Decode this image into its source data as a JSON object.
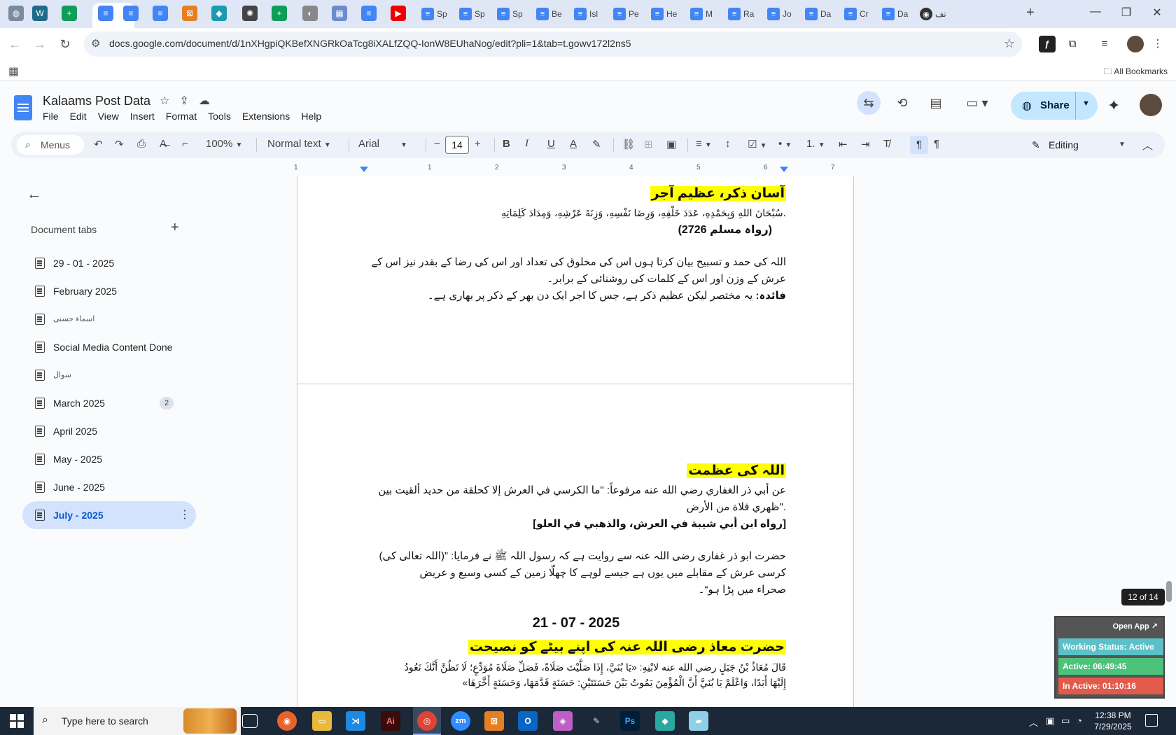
{
  "browser": {
    "tabs": [
      "Sp",
      "Sp",
      "Sp",
      "Be",
      "Isl",
      "Pe",
      "He",
      "M",
      "Ra",
      "Jo",
      "Da",
      "Cr",
      "Da",
      "تف"
    ],
    "url": "docs.google.com/document/d/1nXHgpiQKBefXNGRkOaTcg8iXALfZQQ-IonW8EUhaNog/edit?pli=1&tab=t.gowv172l2ns5",
    "all_bookmarks": "All Bookmarks",
    "new_tab": "+"
  },
  "docs": {
    "title": "Kalaams Post Data",
    "menu": [
      "File",
      "Edit",
      "View",
      "Insert",
      "Format",
      "Tools",
      "Extensions",
      "Help"
    ],
    "share_label": "Share"
  },
  "toolbar": {
    "menus_label": "Menus",
    "zoom": "100%",
    "style": "Normal text",
    "font": "Arial",
    "font_size": "14",
    "mode": "Editing"
  },
  "ruler": [
    "1",
    "1",
    "2",
    "3",
    "4",
    "5",
    "6",
    "7"
  ],
  "sidebar": {
    "heading": "Document tabs",
    "tabs": [
      {
        "label": "29 - 01 - 2025"
      },
      {
        "label": "February 2025"
      },
      {
        "label": "اسماء حسنی"
      },
      {
        "label": "Social Media Content Done"
      },
      {
        "label": "سوال"
      },
      {
        "label": "March 2025",
        "badge": "2"
      },
      {
        "label": "April 2025"
      },
      {
        "label": "May - 2025"
      },
      {
        "label": "June - 2025"
      },
      {
        "label": "July - 2025"
      }
    ]
  },
  "document": {
    "page1": {
      "heading": "آسان ذکر، عظیم آجر",
      "arabic": ".سُبْحَانَ اللهِ وَبِحَمْدِهِ، عَدَدَ خَلْقِهِ، وَرِضَا نَفْسِهِ، وَزِنَةَ عَرْشِهِ، وَمِدَادَ كَلِمَاتِهِ",
      "reference": "(رواہ مسلم 2726)",
      "translation_1": "اللہ کی حمد و تسبیح بیان کرتا ہوں اس کی مخلوق کی تعداد اور اس کی رضا کے بقدر نیز اس کے",
      "translation_2": "عرش کے وزن اور اس کے کلمات کی روشنائی کے برابر۔",
      "benefit_label": "فائدہ:",
      "benefit_text": " یہ مختصر لیکن عظیم ذکر ہے، جس کا اجر ایک دن بھر کے ذکر پر بھاری ہے۔"
    },
    "page2": {
      "heading": "اللہ کی عظمت",
      "arabic_1": "عن أبي ذر الغفاري رضي الله عنه مرفوعاً: \"ما الكرسي في العرش إلا كحلقة من حديد ألقيت بين",
      "arabic_2": ".\"ظهري فلاة من الأرض",
      "reference": "[رواه ابن أبي شيبة في العرش، والذهبي في العلو]",
      "urdu_1": "حضرت ابو ذر غفاری رضی اللہ عنہ سے روایت ہے کہ رسول اللہ ﷺ نے فرمایا: ”(اللہ تعالی کی)",
      "urdu_2": "کرسی عرش کے مقابلے میں یوں ہے جیسے لوہے کا چھلّا زمین کے کسی وسیع و عریض",
      "urdu_3": "صحراء میں پڑا ہو“۔",
      "date": "21 - 07 - 2025",
      "heading_2": "حضرت معاذ رضی اللہ عنہ کی اپنے بیٹے کو نصیحت",
      "arabic_3": "قَالَ مُعَاذُ بْنُ جَبَلٍ رضي الله عنه لابْنِهِ: «يَا بُنَيَّ، إِذَا صَلَّيْتَ صَلَاةً، فَصَلِّ صَلَاةَ مُوَدِّعٍ؛ لَا تَظُنَّ أَنَّكَ تَعُودُ",
      "arabic_4": "إِلَيْهَا أَبَدًا، وَاعْلَمْ يَا بُنَيَّ أَنَّ الْمُؤْمِنَ يَمُوتُ بَيْنَ حَسَنَتَيْنِ: حَسَنَةٍ قَدَّمَهَا، وَحَسَنَةٍ أَخَّرَهَا»"
    }
  },
  "page_indicator": "12 of 14",
  "widget": {
    "open_app": "Open App ↗",
    "status": "Working Status: Active",
    "active": "Active: 06:49:45",
    "inactive": "In Active: 01:10:16",
    "status_color": "#5bc0c8",
    "active_color": "#4cc27a",
    "inactive_color": "#e25a4a"
  },
  "taskbar": {
    "search_placeholder": "Type here to search",
    "time": "12:38 PM",
    "date": "7/29/2025"
  }
}
